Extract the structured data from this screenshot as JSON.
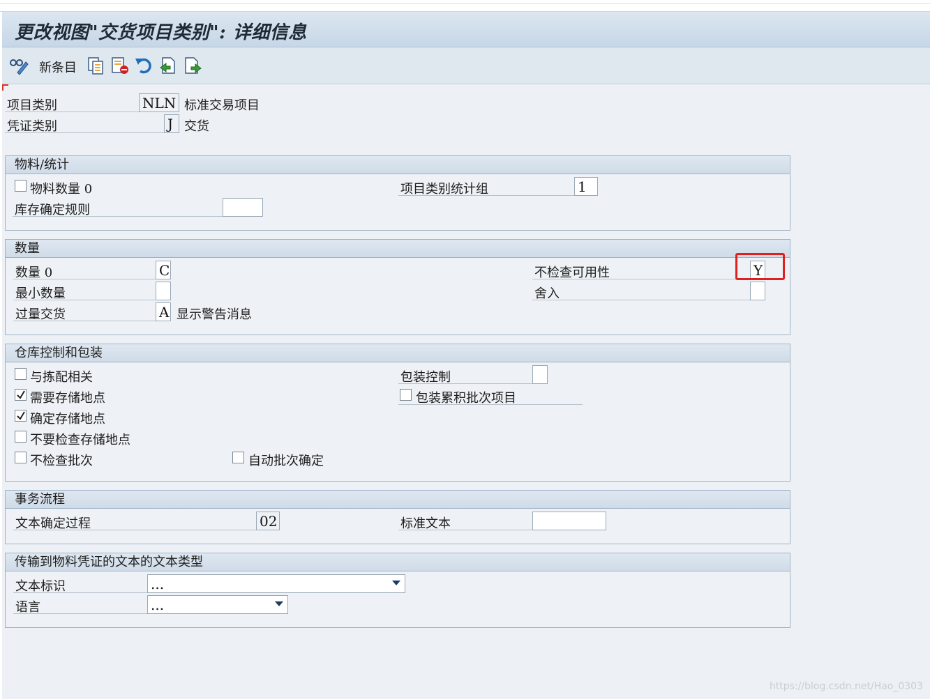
{
  "window": {
    "title": "更改视图\"交货项目类别\": 详细信息"
  },
  "toolbar": {
    "new_entries_label": "新条目"
  },
  "header": {
    "item_category_label": "项目类别",
    "item_category_value": "NLN",
    "item_category_desc": "标准交易项目",
    "doc_category_label": "凭证类别",
    "doc_category_value": "J",
    "doc_category_desc": "交货"
  },
  "groups": {
    "material": {
      "title": "物料/统计",
      "material_qty_zero_label": "物料数量 0",
      "material_qty_zero_checked": false,
      "stat_group_label": "项目类别统计组",
      "stat_group_value": "1",
      "stock_rule_label": "库存确定规则",
      "stock_rule_value": ""
    },
    "quantity": {
      "title": "数量",
      "qty_zero_label": "数量 0",
      "qty_zero_value": "C",
      "no_avail_check_label": "不检查可用性",
      "no_avail_check_value": "Y",
      "min_qty_label": "最小数量",
      "min_qty_value": "",
      "rounding_label": "舍入",
      "rounding_value": "",
      "overdelivery_label": "过量交货",
      "overdelivery_value": "A",
      "overdelivery_desc": "显示警告消息"
    },
    "warehouse": {
      "title": "仓库控制和包装",
      "picking_relevant_label": "与拣配相关",
      "picking_relevant_checked": false,
      "sloc_required_label": "需要存储地点",
      "sloc_required_checked": true,
      "determine_sloc_label": "确定存储地点",
      "determine_sloc_checked": true,
      "no_sloc_check_label": "不要检查存储地点",
      "no_sloc_check_checked": false,
      "no_batch_check_label": "不检查批次",
      "no_batch_check_checked": false,
      "auto_batch_label": "自动批次确定",
      "auto_batch_checked": false,
      "packing_control_label": "包装控制",
      "packing_control_value": "",
      "pack_accum_batch_label": "包装累积批次项目",
      "pack_accum_batch_checked": false
    },
    "transaction": {
      "title": "事务流程",
      "text_det_proc_label": "文本确定过程",
      "text_det_proc_value": "02",
      "standard_text_label": "标准文本",
      "standard_text_value": ""
    },
    "text_types": {
      "title": "传输到物料凭证的文本的文本类型",
      "text_id_label": "文本标识",
      "text_id_value": "...",
      "language_label": "语言",
      "language_value": "..."
    }
  },
  "watermark": "https://blog.csdn.net/Hao_0303"
}
